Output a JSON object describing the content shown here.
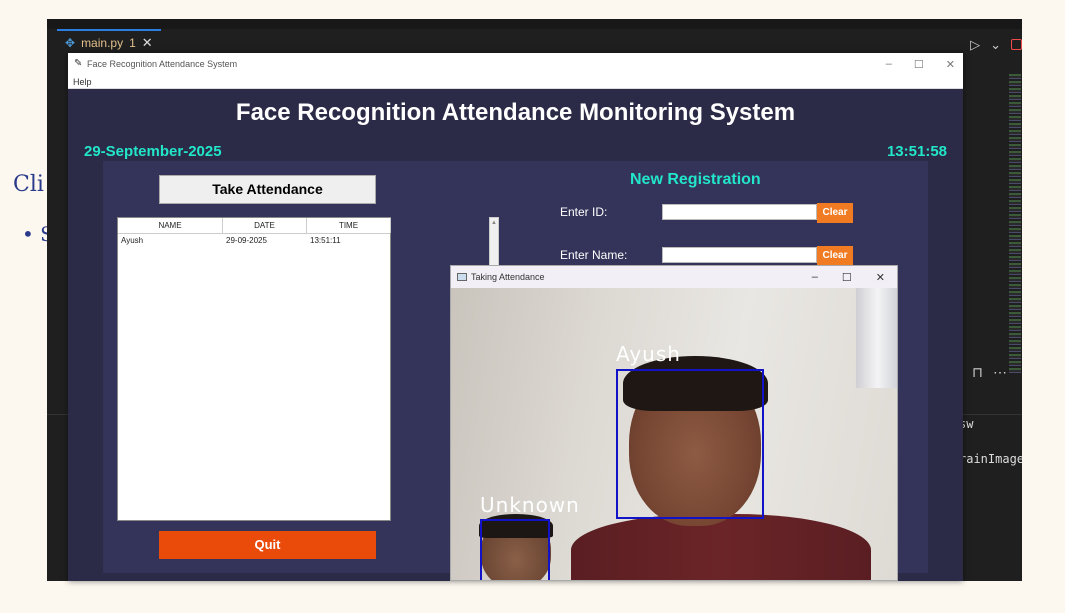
{
  "document": {
    "left_text": "Cli",
    "bullet_text": "S"
  },
  "vscode": {
    "tab": {
      "filename": "main.py",
      "problem_count": "1"
    },
    "terminal_lines": [
      "sw",
      "rainImage"
    ]
  },
  "main_window": {
    "title": "Face Recognition Attendance System",
    "menu": [
      "Help"
    ],
    "heading": "Face Recognition Attendance Monitoring System",
    "date": "29-September-2025",
    "time": "13:51:58",
    "take_attendance_label": "Take Attendance",
    "quit_label": "Quit",
    "table": {
      "headers": [
        "NAME",
        "DATE",
        "TIME"
      ],
      "rows": [
        {
          "name": "Ayush",
          "date": "29-09-2025",
          "time": "13:51:11"
        }
      ]
    },
    "registration": {
      "title": "New Registration",
      "id_label": "Enter ID:",
      "name_label": "Enter Name:",
      "clear_label": "Clear",
      "id_value": "",
      "name_value": ""
    },
    "colors": {
      "accent": "#22e6c9",
      "quit": "#ea4a0a",
      "clear": "#f07b22",
      "background": "#2b2a47"
    }
  },
  "camera_window": {
    "title": "Taking Attendance",
    "detections": [
      {
        "label": "Ayush"
      },
      {
        "label": "Unknown"
      }
    ],
    "box_color": "#1212c8"
  }
}
